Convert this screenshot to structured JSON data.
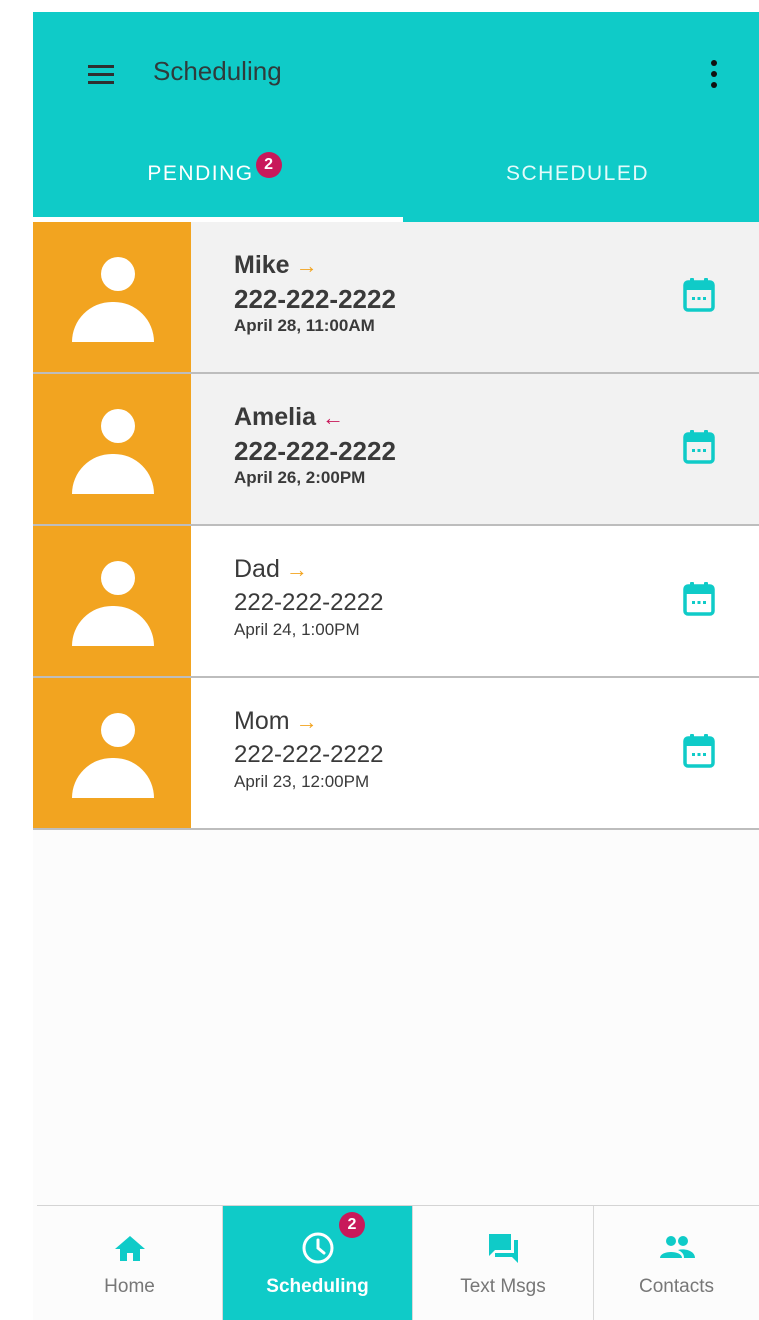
{
  "appbar": {
    "title": "Scheduling",
    "menu_icon": "hamburger-menu-icon",
    "more_icon": "more-vertical-icon"
  },
  "tabs": [
    {
      "label": "PENDING",
      "badge": "2",
      "active": true
    },
    {
      "label": "SCHEDULED",
      "active": false
    }
  ],
  "contacts": [
    {
      "name": "Mike",
      "direction": "outgoing",
      "arrow": "→",
      "phone": "222-222-2222",
      "date": "April 28, 11:00AM",
      "unread": true
    },
    {
      "name": "Amelia",
      "direction": "incoming",
      "arrow": "←",
      "phone": "222-222-2222",
      "date": "April 26, 2:00PM",
      "unread": true
    },
    {
      "name": "Dad",
      "direction": "outgoing",
      "arrow": "→",
      "phone": "222-222-2222",
      "date": "April 24, 1:00PM",
      "unread": false
    },
    {
      "name": "Mom",
      "direction": "outgoing",
      "arrow": "→",
      "phone": "222-222-2222",
      "date": "April 23, 12:00PM",
      "unread": false
    }
  ],
  "bottom_nav": [
    {
      "label": "Home",
      "icon": "home-icon",
      "active": false
    },
    {
      "label": "Scheduling",
      "icon": "clock-icon",
      "badge": "2",
      "active": true
    },
    {
      "label": "Text Msgs",
      "icon": "chat-icon",
      "active": false
    },
    {
      "label": "Contacts",
      "icon": "people-icon",
      "active": false
    }
  ],
  "colors": {
    "primary": "#0fcbc8",
    "avatar": "#f2a420",
    "badge": "#c8195a",
    "incoming_arrow": "#c8195a",
    "outgoing_arrow": "#f2a420"
  }
}
